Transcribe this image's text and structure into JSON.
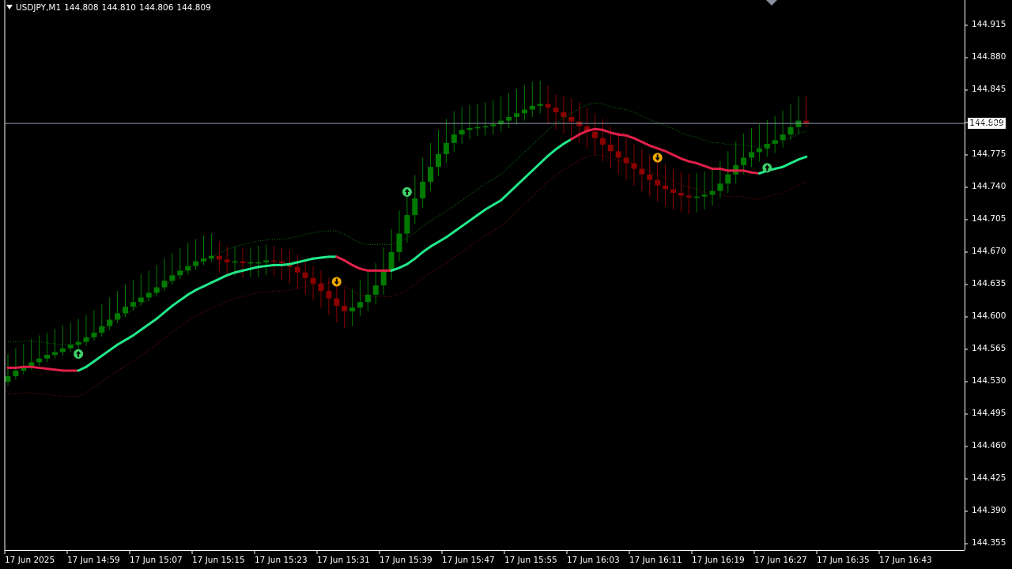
{
  "window": {
    "symbol": "USDJPY,M1",
    "ohlc": [
      "144.808",
      "144.810",
      "144.806",
      "144.809"
    ],
    "current_price": "144.809",
    "colors": {
      "bull": "#007a00",
      "bear": "#8b0000",
      "ma_up": "#22e88a",
      "ma_down": "#e0204a",
      "upper_band": "#0f7a0f",
      "lower_band": "#7a0f0f",
      "price_line": "#8c96a8",
      "signal_up": "#3fd16a",
      "signal_down": "#f0a800",
      "axis": "#ffffff"
    }
  },
  "chart_data": {
    "type": "candlestick",
    "title": "",
    "grid": false,
    "ylim": [
      144.335,
      144.935
    ],
    "y_ticks": [
      "144.915",
      "144.880",
      "144.845",
      "144.810",
      "144.775",
      "144.740",
      "144.705",
      "144.670",
      "144.635",
      "144.600",
      "144.565",
      "144.530",
      "144.495",
      "144.460",
      "144.425",
      "144.390",
      "144.355"
    ],
    "x_ticks": [
      "17 Jun 2025",
      "17 Jun 14:59",
      "17 Jun 15:07",
      "17 Jun 15:15",
      "17 Jun 15:23",
      "17 Jun 15:31",
      "17 Jun 15:39",
      "17 Jun 15:47",
      "17 Jun 15:55",
      "17 Jun 16:03",
      "17 Jun 16:11",
      "17 Jun 16:19",
      "17 Jun 16:27",
      "17 Jun 16:35",
      "17 Jun 16:43"
    ],
    "mid_line": [
      144.545,
      144.545,
      144.546,
      144.546,
      144.545,
      144.544,
      144.543,
      144.542,
      144.542,
      144.542,
      144.546,
      144.552,
      144.558,
      144.564,
      144.57,
      144.575,
      144.58,
      144.586,
      144.592,
      144.598,
      144.605,
      144.612,
      144.618,
      144.624,
      144.629,
      144.633,
      144.637,
      144.641,
      144.645,
      144.648,
      144.65,
      144.652,
      144.654,
      144.655,
      144.656,
      144.656,
      144.657,
      144.659,
      144.661,
      144.663,
      144.664,
      144.665,
      144.665,
      144.661,
      144.656,
      144.652,
      144.65,
      144.65,
      144.65,
      144.65,
      144.653,
      144.657,
      144.663,
      144.67,
      144.676,
      144.681,
      144.686,
      144.692,
      144.698,
      144.704,
      144.71,
      144.716,
      144.721,
      144.726,
      144.734,
      144.742,
      144.75,
      144.758,
      144.766,
      144.774,
      144.781,
      144.787,
      144.792,
      144.797,
      144.801,
      144.803,
      144.802,
      144.799,
      144.797,
      144.796,
      144.793,
      144.789,
      144.785,
      144.782,
      144.779,
      144.775,
      144.771,
      144.768,
      144.766,
      144.763,
      144.76,
      144.76,
      144.758,
      144.758,
      144.758,
      144.756,
      144.755,
      144.758,
      144.76,
      144.762,
      144.766,
      144.77,
      144.773
    ],
    "mid_line_state": [
      0,
      0,
      0,
      0,
      0,
      0,
      0,
      0,
      0,
      0,
      1,
      1,
      1,
      1,
      1,
      1,
      1,
      1,
      1,
      1,
      1,
      1,
      1,
      1,
      1,
      1,
      1,
      1,
      1,
      1,
      1,
      1,
      1,
      1,
      1,
      1,
      1,
      1,
      1,
      1,
      1,
      1,
      1,
      0,
      0,
      0,
      0,
      0,
      0,
      0,
      1,
      1,
      1,
      1,
      1,
      1,
      1,
      1,
      1,
      1,
      1,
      1,
      1,
      1,
      1,
      1,
      1,
      1,
      1,
      1,
      1,
      1,
      1,
      0,
      0,
      0,
      0,
      0,
      0,
      0,
      0,
      0,
      0,
      0,
      0,
      0,
      0,
      0,
      0,
      0,
      0,
      0,
      0,
      0,
      0,
      0,
      0,
      1,
      1,
      1,
      1,
      1,
      1
    ],
    "upper_band": [
      144.573,
      144.573,
      144.574,
      144.574,
      144.573,
      144.572,
      144.571,
      144.57,
      144.57,
      144.57,
      144.574,
      144.58,
      144.586,
      144.592,
      144.598,
      144.603,
      144.608,
      144.614,
      144.62,
      144.626,
      144.633,
      144.64,
      144.646,
      144.652,
      144.657,
      144.661,
      144.665,
      144.669,
      144.673,
      144.676,
      144.678,
      144.68,
      144.682,
      144.683,
      144.684,
      144.684,
      144.685,
      144.687,
      144.689,
      144.691,
      144.692,
      144.693,
      144.693,
      144.689,
      144.684,
      144.68,
      144.678,
      144.678,
      144.678,
      144.678,
      144.681,
      144.685,
      144.691,
      144.698,
      144.704,
      144.709,
      144.714,
      144.72,
      144.726,
      144.732,
      144.738,
      144.744,
      144.749,
      144.754,
      144.762,
      144.77,
      144.778,
      144.786,
      144.794,
      144.802,
      144.809,
      144.815,
      144.82,
      144.825,
      144.829,
      144.831,
      144.83,
      144.827,
      144.825,
      144.824,
      144.821,
      144.817,
      144.813,
      144.81,
      144.807,
      144.803,
      144.799,
      144.796,
      144.794,
      144.791,
      144.788,
      144.788,
      144.786,
      144.786,
      144.786,
      144.784,
      144.783,
      144.786,
      144.788,
      144.79,
      144.794,
      144.798,
      144.801
    ],
    "lower_band": [
      144.517,
      144.517,
      144.518,
      144.518,
      144.517,
      144.516,
      144.515,
      144.514,
      144.514,
      144.514,
      144.518,
      144.524,
      144.53,
      144.536,
      144.542,
      144.547,
      144.552,
      144.558,
      144.564,
      144.57,
      144.577,
      144.584,
      144.59,
      144.596,
      144.601,
      144.605,
      144.609,
      144.613,
      144.617,
      144.62,
      144.622,
      144.624,
      144.626,
      144.627,
      144.628,
      144.628,
      144.629,
      144.631,
      144.633,
      144.635,
      144.636,
      144.637,
      144.637,
      144.633,
      144.628,
      144.624,
      144.622,
      144.622,
      144.622,
      144.622,
      144.625,
      144.629,
      144.635,
      144.642,
      144.648,
      144.653,
      144.658,
      144.664,
      144.67,
      144.676,
      144.682,
      144.688,
      144.693,
      144.698,
      144.706,
      144.714,
      144.722,
      144.73,
      144.738,
      144.746,
      144.753,
      144.759,
      144.764,
      144.769,
      144.773,
      144.775,
      144.774,
      144.771,
      144.769,
      144.768,
      144.765,
      144.761,
      144.757,
      144.754,
      144.751,
      144.747,
      144.743,
      144.74,
      144.738,
      144.735,
      144.732,
      144.732,
      144.73,
      144.73,
      144.73,
      144.728,
      144.727,
      144.73,
      144.732,
      144.734,
      144.738,
      144.742,
      144.745
    ],
    "candles": {
      "open": [
        144.53,
        144.536,
        144.542,
        144.547,
        144.551,
        144.555,
        144.559,
        144.562,
        144.566,
        144.57,
        144.573,
        144.578,
        144.583,
        144.59,
        144.597,
        144.604,
        144.611,
        144.616,
        144.621,
        144.626,
        144.632,
        144.639,
        144.645,
        144.65,
        144.655,
        144.66,
        144.663,
        144.666,
        144.662,
        144.659,
        144.66,
        144.658,
        144.659,
        144.659,
        144.661,
        144.66,
        144.658,
        144.654,
        144.648,
        144.642,
        144.636,
        144.628,
        144.62,
        144.612,
        144.606,
        144.61,
        144.616,
        144.624,
        144.634,
        144.65,
        144.67,
        144.69,
        144.71,
        144.728,
        144.746,
        144.762,
        144.776,
        144.788,
        144.797,
        144.802,
        144.804,
        144.805,
        144.806,
        144.808,
        144.812,
        144.816,
        144.82,
        144.824,
        144.828,
        144.83,
        144.826,
        144.821,
        144.816,
        144.811,
        144.806,
        144.8,
        144.793,
        144.786,
        144.779,
        144.772,
        144.766,
        144.76,
        144.754,
        144.748,
        144.742,
        144.738,
        144.734,
        144.731,
        144.729,
        144.73,
        144.732,
        144.736,
        144.744,
        144.754,
        144.764,
        144.772,
        144.778,
        144.782,
        144.787,
        144.791,
        144.797,
        144.805,
        144.812
      ],
      "close": [
        144.536,
        144.542,
        144.547,
        144.551,
        144.555,
        144.559,
        144.562,
        144.566,
        144.57,
        144.573,
        144.578,
        144.583,
        144.59,
        144.597,
        144.604,
        144.611,
        144.616,
        144.621,
        144.626,
        144.632,
        144.639,
        144.645,
        144.65,
        144.655,
        144.66,
        144.663,
        144.666,
        144.662,
        144.659,
        144.66,
        144.658,
        144.659,
        144.659,
        144.661,
        144.66,
        144.658,
        144.654,
        144.648,
        144.642,
        144.636,
        144.628,
        144.62,
        144.612,
        144.606,
        144.61,
        144.616,
        144.624,
        144.634,
        144.65,
        144.67,
        144.69,
        144.71,
        144.728,
        144.746,
        144.762,
        144.776,
        144.788,
        144.797,
        144.802,
        144.804,
        144.805,
        144.806,
        144.808,
        144.812,
        144.816,
        144.82,
        144.824,
        144.828,
        144.83,
        144.826,
        144.821,
        144.816,
        144.811,
        144.806,
        144.8,
        144.793,
        144.786,
        144.779,
        144.772,
        144.766,
        144.76,
        144.754,
        144.748,
        144.742,
        144.738,
        144.734,
        144.731,
        144.729,
        144.73,
        144.732,
        144.736,
        144.744,
        144.754,
        144.764,
        144.772,
        144.778,
        144.782,
        144.787,
        144.791,
        144.797,
        144.805,
        144.812,
        144.809
      ],
      "high": [
        144.56,
        144.566,
        144.571,
        144.576,
        144.58,
        144.583,
        144.587,
        144.591,
        144.594,
        144.598,
        144.602,
        144.607,
        144.614,
        144.621,
        144.628,
        144.635,
        144.64,
        144.646,
        144.65,
        144.656,
        144.663,
        144.669,
        144.674,
        144.68,
        144.684,
        144.688,
        144.69,
        144.681,
        144.676,
        144.676,
        144.675,
        144.675,
        144.677,
        144.678,
        144.677,
        144.675,
        144.672,
        144.667,
        144.662,
        144.655,
        144.65,
        144.642,
        144.634,
        144.63,
        144.63,
        144.64,
        144.648,
        144.658,
        144.675,
        144.695,
        144.715,
        144.735,
        144.753,
        144.772,
        144.788,
        144.802,
        144.814,
        144.822,
        144.827,
        144.829,
        144.83,
        144.832,
        144.834,
        144.838,
        144.842,
        144.846,
        144.85,
        144.854,
        144.855,
        144.85,
        144.84,
        144.838,
        144.836,
        144.832,
        144.826,
        144.82,
        144.814,
        144.806,
        144.8,
        144.793,
        144.787,
        144.782,
        144.776,
        144.77,
        144.765,
        144.76,
        144.757,
        144.755,
        144.755,
        144.757,
        144.76,
        144.768,
        144.779,
        144.789,
        144.798,
        144.804,
        144.808,
        144.813,
        144.817,
        144.823,
        144.83,
        144.838,
        144.838
      ],
      "low": [
        144.526,
        144.532,
        144.538,
        144.543,
        144.547,
        144.551,
        144.555,
        144.558,
        144.562,
        144.566,
        144.569,
        144.574,
        144.579,
        144.586,
        144.593,
        144.6,
        144.607,
        144.612,
        144.617,
        144.622,
        144.628,
        144.635,
        144.641,
        144.646,
        144.651,
        144.656,
        144.659,
        144.648,
        144.643,
        144.644,
        144.642,
        144.643,
        144.643,
        144.645,
        144.644,
        144.64,
        144.636,
        144.63,
        144.624,
        144.618,
        144.61,
        144.602,
        144.594,
        144.588,
        144.59,
        144.601,
        144.606,
        144.614,
        144.624,
        144.64,
        144.66,
        144.68,
        144.7,
        144.718,
        144.736,
        144.752,
        144.766,
        144.778,
        144.787,
        144.792,
        144.795,
        144.796,
        144.797,
        144.8,
        144.804,
        144.808,
        144.812,
        144.816,
        144.82,
        144.808,
        144.803,
        144.798,
        144.793,
        144.788,
        144.782,
        144.775,
        144.768,
        144.761,
        144.754,
        144.748,
        144.742,
        144.736,
        144.73,
        144.724,
        144.72,
        144.716,
        144.713,
        144.711,
        144.713,
        144.716,
        144.72,
        144.728,
        144.734,
        144.744,
        144.754,
        144.762,
        144.768,
        144.773,
        144.777,
        144.783,
        144.791,
        144.798,
        144.805
      ]
    },
    "signals": [
      {
        "index": 9,
        "direction": "up",
        "price": 144.56
      },
      {
        "index": 42,
        "direction": "down",
        "price": 144.638
      },
      {
        "index": 51,
        "direction": "up",
        "price": 144.735
      },
      {
        "index": 83,
        "direction": "down",
        "price": 144.772
      },
      {
        "index": 97,
        "direction": "up",
        "price": 144.761
      }
    ]
  }
}
